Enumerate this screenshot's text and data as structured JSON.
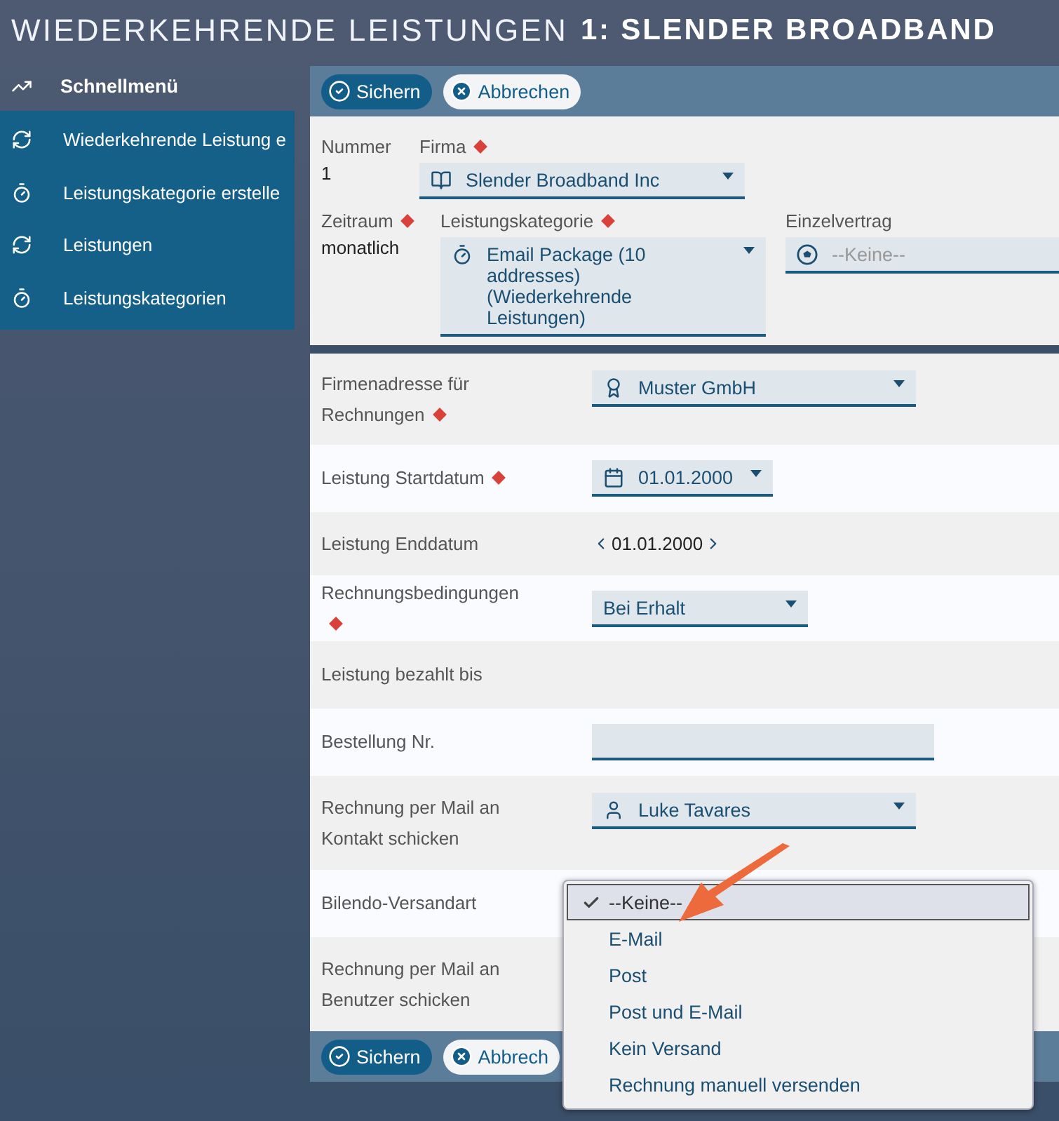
{
  "title": {
    "light": "WIEDERKEHRENDE LEISTUNGEN",
    "bold": "1: SLENDER BROADBAND"
  },
  "sidebar": {
    "header": {
      "label": "Schnellmenü"
    },
    "items": [
      {
        "label": "Wiederkehrende Leistung e"
      },
      {
        "label": "Leistungskategorie erstelle"
      },
      {
        "label": "Leistungen"
      },
      {
        "label": "Leistungskategorien"
      }
    ]
  },
  "toolbar_top": {
    "buttons": [
      {
        "label": "Sichern",
        "kind": "primary"
      },
      {
        "label": "Abbrechen",
        "kind": "secondary"
      }
    ]
  },
  "header": {
    "nummer": {
      "label": "Nummer",
      "value": "1"
    },
    "firma": {
      "label": "Firma",
      "required": true,
      "value": "Slender Broadband Inc"
    },
    "zeitraum": {
      "label": "Zeitraum",
      "required": true,
      "value": "monatlich"
    },
    "kategorie": {
      "label": "Leistungskategorie",
      "required": true,
      "value": "Email Package (10 addresses) (Wiederkehrende Leistungen)"
    },
    "einzelvertrag": {
      "label": "Einzelvertrag",
      "placeholder": "--Keine--"
    }
  },
  "rows": [
    {
      "label": "Firmenadresse für Rechnungen",
      "required": true,
      "kind": "select",
      "value": "Muster GmbH"
    },
    {
      "label": "Leistung Startdatum",
      "required": true,
      "kind": "select",
      "value": "01.01.2000"
    },
    {
      "label": "Leistung Enddatum",
      "required": false,
      "kind": "datenav",
      "value": "01.01.2000"
    },
    {
      "label": "Rechnungsbedingungen",
      "required": true,
      "kind": "select",
      "value": "Bei Erhalt"
    },
    {
      "label": "Leistung bezahlt bis",
      "required": false,
      "kind": "empty"
    },
    {
      "label": "Bestellung Nr.",
      "required": false,
      "kind": "text"
    },
    {
      "label": "Rechnung per Mail an Kontakt schicken",
      "required": false,
      "kind": "select",
      "value": "Luke Tavares"
    },
    {
      "label": "Bilendo-Versandart",
      "required": false,
      "kind": "empty"
    },
    {
      "label": "Rechnung per Mail an Benutzer schicken",
      "required": false,
      "kind": "empty"
    }
  ],
  "dropdown": {
    "options": [
      {
        "label": "--Keine--",
        "selected": true
      },
      {
        "label": "E-Mail",
        "selected": false
      },
      {
        "label": "Post",
        "selected": false
      },
      {
        "label": "Post und E-Mail",
        "selected": false
      },
      {
        "label": "Kein Versand",
        "selected": false
      },
      {
        "label": "Rechnung manuell versenden",
        "selected": false
      }
    ]
  },
  "toolbar_bottom": {
    "buttons": [
      {
        "label": "Sichern",
        "kind": "primary"
      },
      {
        "label": "Abbrech",
        "kind": "secondary"
      }
    ]
  }
}
